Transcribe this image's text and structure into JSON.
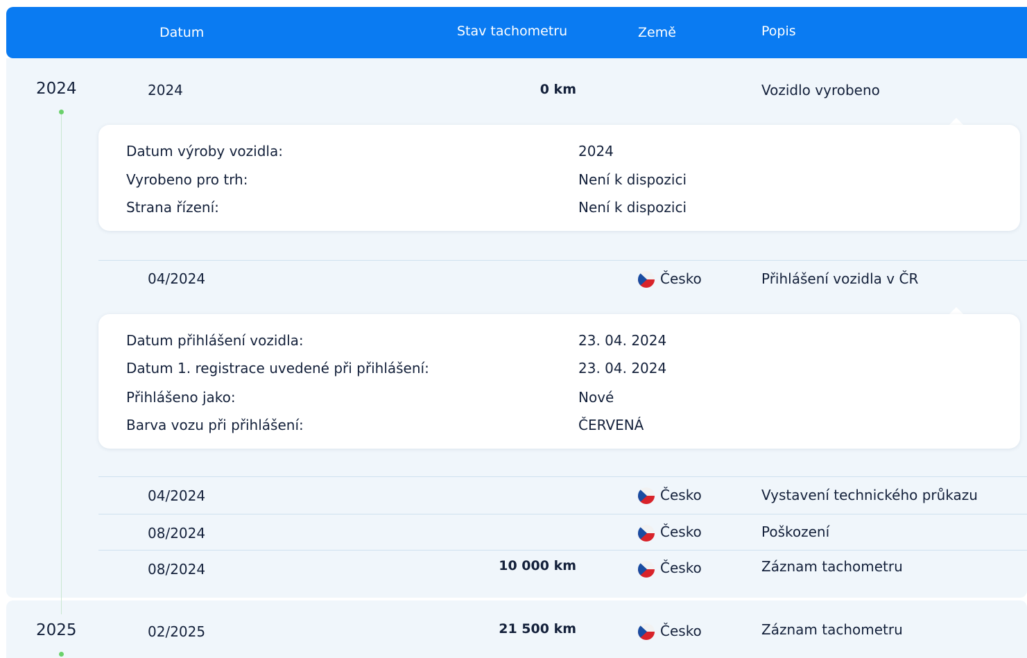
{
  "header": {
    "datum": "Datum",
    "stav": "Stav tachometru",
    "zeme": "Země",
    "popis": "Popis"
  },
  "years": [
    {
      "year": "2024",
      "rows": [
        {
          "date": "2024",
          "km": "0 km",
          "country": "",
          "desc": "Vozidlo vyrobeno"
        },
        {
          "date": "04/2024",
          "km": "",
          "country": "Česko",
          "desc": "Přihlášení vozidla v ČR"
        },
        {
          "date": "04/2024",
          "km": "",
          "country": "Česko",
          "desc": "Vystavení technického průkazu"
        },
        {
          "date": "08/2024",
          "km": "",
          "country": "Česko",
          "desc": "Poškození"
        },
        {
          "date": "08/2024",
          "km": "10 000 km",
          "country": "Česko",
          "desc": "Záznam tachometru"
        }
      ]
    },
    {
      "year": "2025",
      "rows": [
        {
          "date": "02/2025",
          "km": "21 500 km",
          "country": "Česko",
          "desc": "Záznam tachometru"
        }
      ]
    }
  ],
  "details": [
    {
      "items": [
        {
          "label": "Datum výroby vozidla:",
          "value": "2024"
        },
        {
          "label": "Vyrobeno pro trh:",
          "value": "Není k dispozici"
        },
        {
          "label": "Strana řízení:",
          "value": "Není k dispozici"
        }
      ]
    },
    {
      "items": [
        {
          "label": "Datum přihlášení vozidla:",
          "value": "23. 04. 2024"
        },
        {
          "label": "Datum 1. registrace uvedené při přihlášení:",
          "value": "23. 04. 2024"
        },
        {
          "label": "Přihlášeno jako:",
          "value": "Nové"
        },
        {
          "label": "Barva vozu při přihlášení:",
          "value": "ČERVENÁ"
        }
      ]
    }
  ],
  "colors": {
    "header_bg": "#0a7bf2",
    "year_block_bg": "#f0f6fb",
    "timeline_dot": "#6bd16b"
  },
  "icons": {
    "flag": "czech-flag-icon"
  }
}
